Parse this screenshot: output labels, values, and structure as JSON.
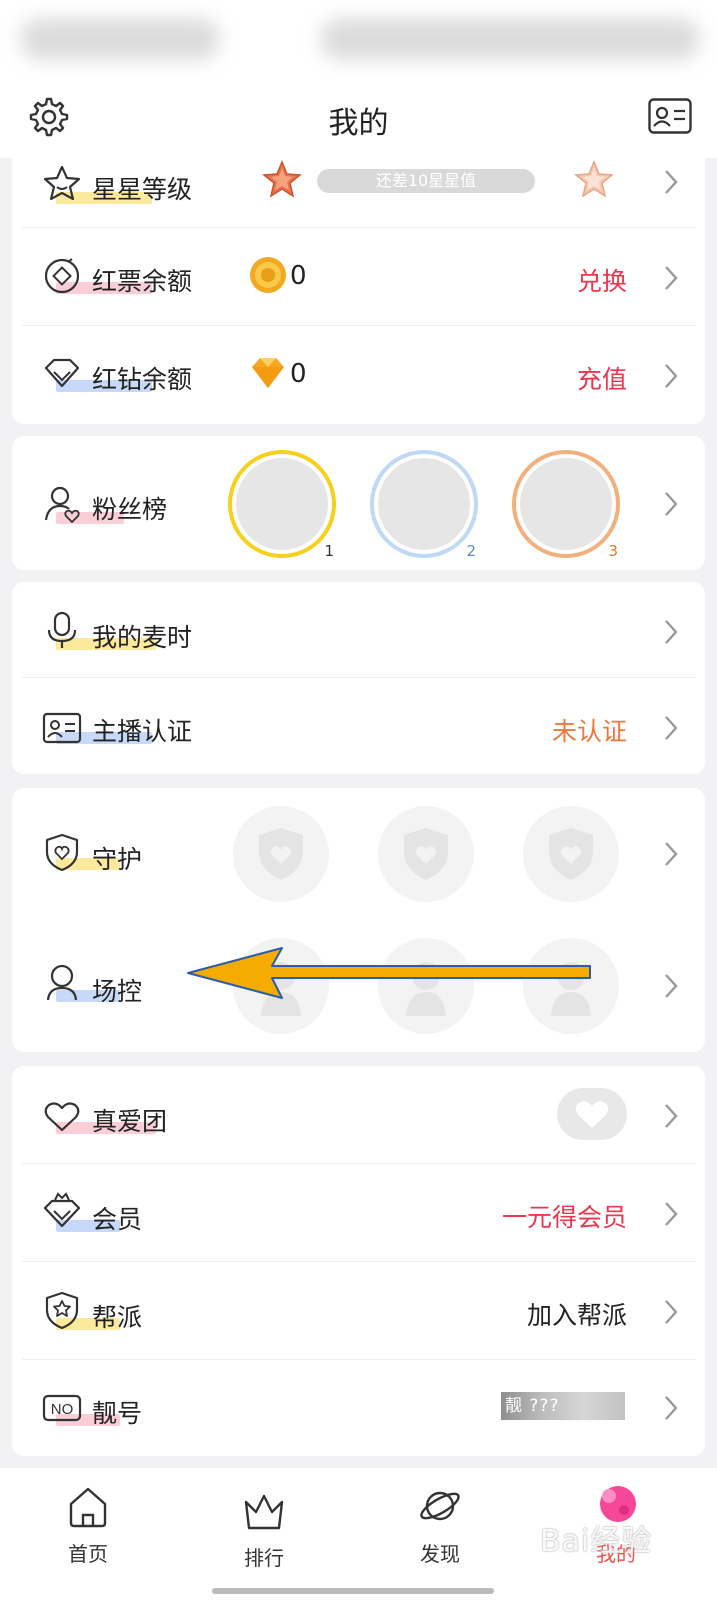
{
  "header": {
    "title": "我的"
  },
  "level": {
    "label": "星星等级",
    "progress_text": "还差10星星值"
  },
  "red_ticket": {
    "label": "红票余额",
    "amount": "0",
    "action": "兑换"
  },
  "red_diamond": {
    "label": "红钻余额",
    "amount": "0",
    "action": "充值"
  },
  "fans": {
    "label": "粉丝榜",
    "ranks": [
      "1",
      "2",
      "3"
    ]
  },
  "mic_time": {
    "label": "我的麦时"
  },
  "anchor_cert": {
    "label": "主播认证",
    "status": "未认证"
  },
  "guard": {
    "label": "守护"
  },
  "field_control": {
    "label": "场控"
  },
  "true_love": {
    "label": "真爱团"
  },
  "member": {
    "label": "会员",
    "action": "一元得会员"
  },
  "gang": {
    "label": "帮派",
    "action": "加入帮派"
  },
  "pretty_number": {
    "label": "靓号",
    "value": "靓 ???"
  },
  "tabbar": {
    "home": "首页",
    "rank": "排行",
    "discover": "发现",
    "mine": "我的"
  },
  "watermark": "Bai经验",
  "colors": {
    "accent_red": "#e8384f",
    "accent_orange": "#f0763a",
    "arrow": "#f5ab00"
  }
}
